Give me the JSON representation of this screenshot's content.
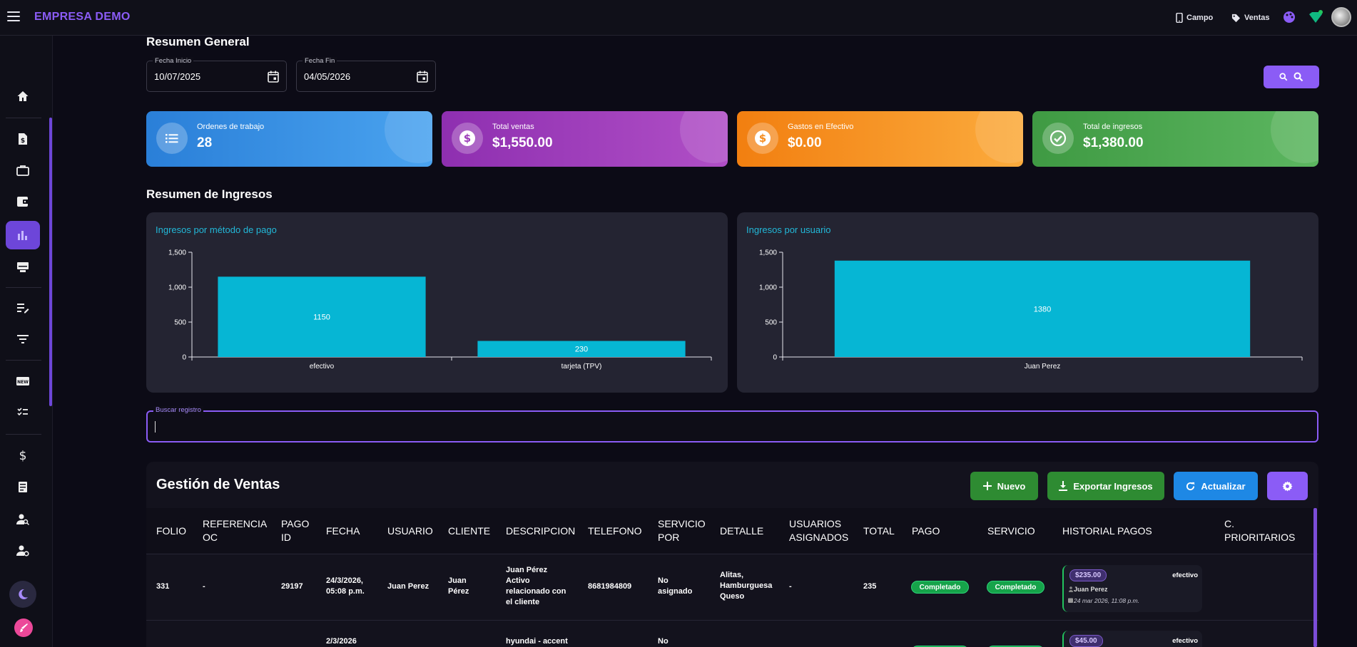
{
  "header": {
    "brand": "EMPRESA DEMO",
    "campo_label": "Campo",
    "ventas_label": "Ventas"
  },
  "sidebar": {
    "items": [
      {
        "icon": "home-icon"
      },
      {
        "icon": "invoice-icon"
      },
      {
        "icon": "briefcase-icon"
      },
      {
        "icon": "wallet-icon"
      },
      {
        "icon": "bar-chart-icon",
        "active": true
      },
      {
        "icon": "monitor-icon"
      },
      {
        "icon": "edit-list-icon"
      },
      {
        "icon": "filter-icon"
      },
      {
        "icon": "new-badge-icon"
      },
      {
        "icon": "checklist-icon"
      },
      {
        "icon": "dollar-icon"
      },
      {
        "icon": "receipt-icon"
      },
      {
        "icon": "user-search-icon"
      },
      {
        "icon": "user-settings-icon"
      },
      {
        "icon": "dark-mode-icon"
      },
      {
        "icon": "paint-icon"
      }
    ]
  },
  "resumen": {
    "title": "Resumen General",
    "fecha_inicio_label": "Fecha Inicio",
    "fecha_inicio": "10/07/2025",
    "fecha_fin_label": "Fecha Fin",
    "fecha_fin": "04/05/2026"
  },
  "stats": [
    {
      "label": "Ordenes de trabajo",
      "value": "28",
      "color": "#2f8fdd"
    },
    {
      "label": "Total ventas",
      "value": "$1,550.00",
      "color": "#9b3db8"
    },
    {
      "label": "Gastos en Efectivo",
      "value": "$0.00",
      "color": "#f58c1f"
    },
    {
      "label": "Total de ingresos",
      "value": "$1,380.00",
      "color": "#43a047"
    }
  ],
  "ingresos": {
    "title": "Resumen de Ingresos"
  },
  "chart_data": [
    {
      "type": "bar",
      "title": "Ingresos por método de pago",
      "categories": [
        "efectivo",
        "tarjeta (TPV)"
      ],
      "values": [
        1150,
        230
      ],
      "ylim": [
        0,
        1500
      ],
      "yticks": [
        0,
        500,
        1000,
        1500
      ],
      "ytick_labels": [
        "0",
        "500",
        "1,000",
        "1,500"
      ],
      "bar_color": "#06b6d4",
      "grid": false
    },
    {
      "type": "bar",
      "title": "Ingresos por usuario",
      "categories": [
        "Juan Perez"
      ],
      "values": [
        1380
      ],
      "ylim": [
        0,
        1500
      ],
      "yticks": [
        0,
        500,
        1000,
        1500
      ],
      "ytick_labels": [
        "0",
        "500",
        "1,000",
        "1,500"
      ],
      "bar_color": "#06b6d4",
      "grid": false
    }
  ],
  "search": {
    "label": "Buscar registro",
    "value": ""
  },
  "ventas": {
    "title": "Gestión de Ventas",
    "nuevo_label": "Nuevo",
    "exportar_label": "Exportar Ingresos",
    "actualizar_label": "Actualizar",
    "columns": [
      "FOLIO",
      "REFERENCIA OC",
      "PAGO ID",
      "FECHA",
      "USUARIO",
      "CLIENTE",
      "DESCRIPCION",
      "TELEFONO",
      "SERVICIO POR",
      "DETALLE",
      "USUARIOS ASIGNADOS",
      "TOTAL",
      "PAGO",
      "SERVICIO",
      "HISTORIAL PAGOS",
      "C. PRIORITARIOS"
    ],
    "rows": [
      {
        "folio": "331",
        "referencia": "-",
        "pago_id": "29197",
        "fecha": "24/3/2026, 05:08 p.m.",
        "usuario": "Juan Perez",
        "cliente": "Juan Pérez",
        "descripcion": "Juan Pérez Activo relacionado con el cliente",
        "telefono": "8681984809",
        "servicio_por": "No asignado",
        "detalle": "Alitas, Hamburguesa Queso",
        "asignados": "-",
        "total": "235",
        "pago": "Completado",
        "servicio": "Completado",
        "hist_amount": "$235.00",
        "hist_method": "efectivo",
        "hist_user": "Juan Perez",
        "hist_date": "24 mar 2026, 11:08 p.m."
      },
      {
        "fecha": "2/3/2026",
        "descripcion": "hyundai - accent",
        "servicio_por": "No",
        "hist_amount": "$45.00",
        "hist_method": "efectivo"
      }
    ]
  }
}
